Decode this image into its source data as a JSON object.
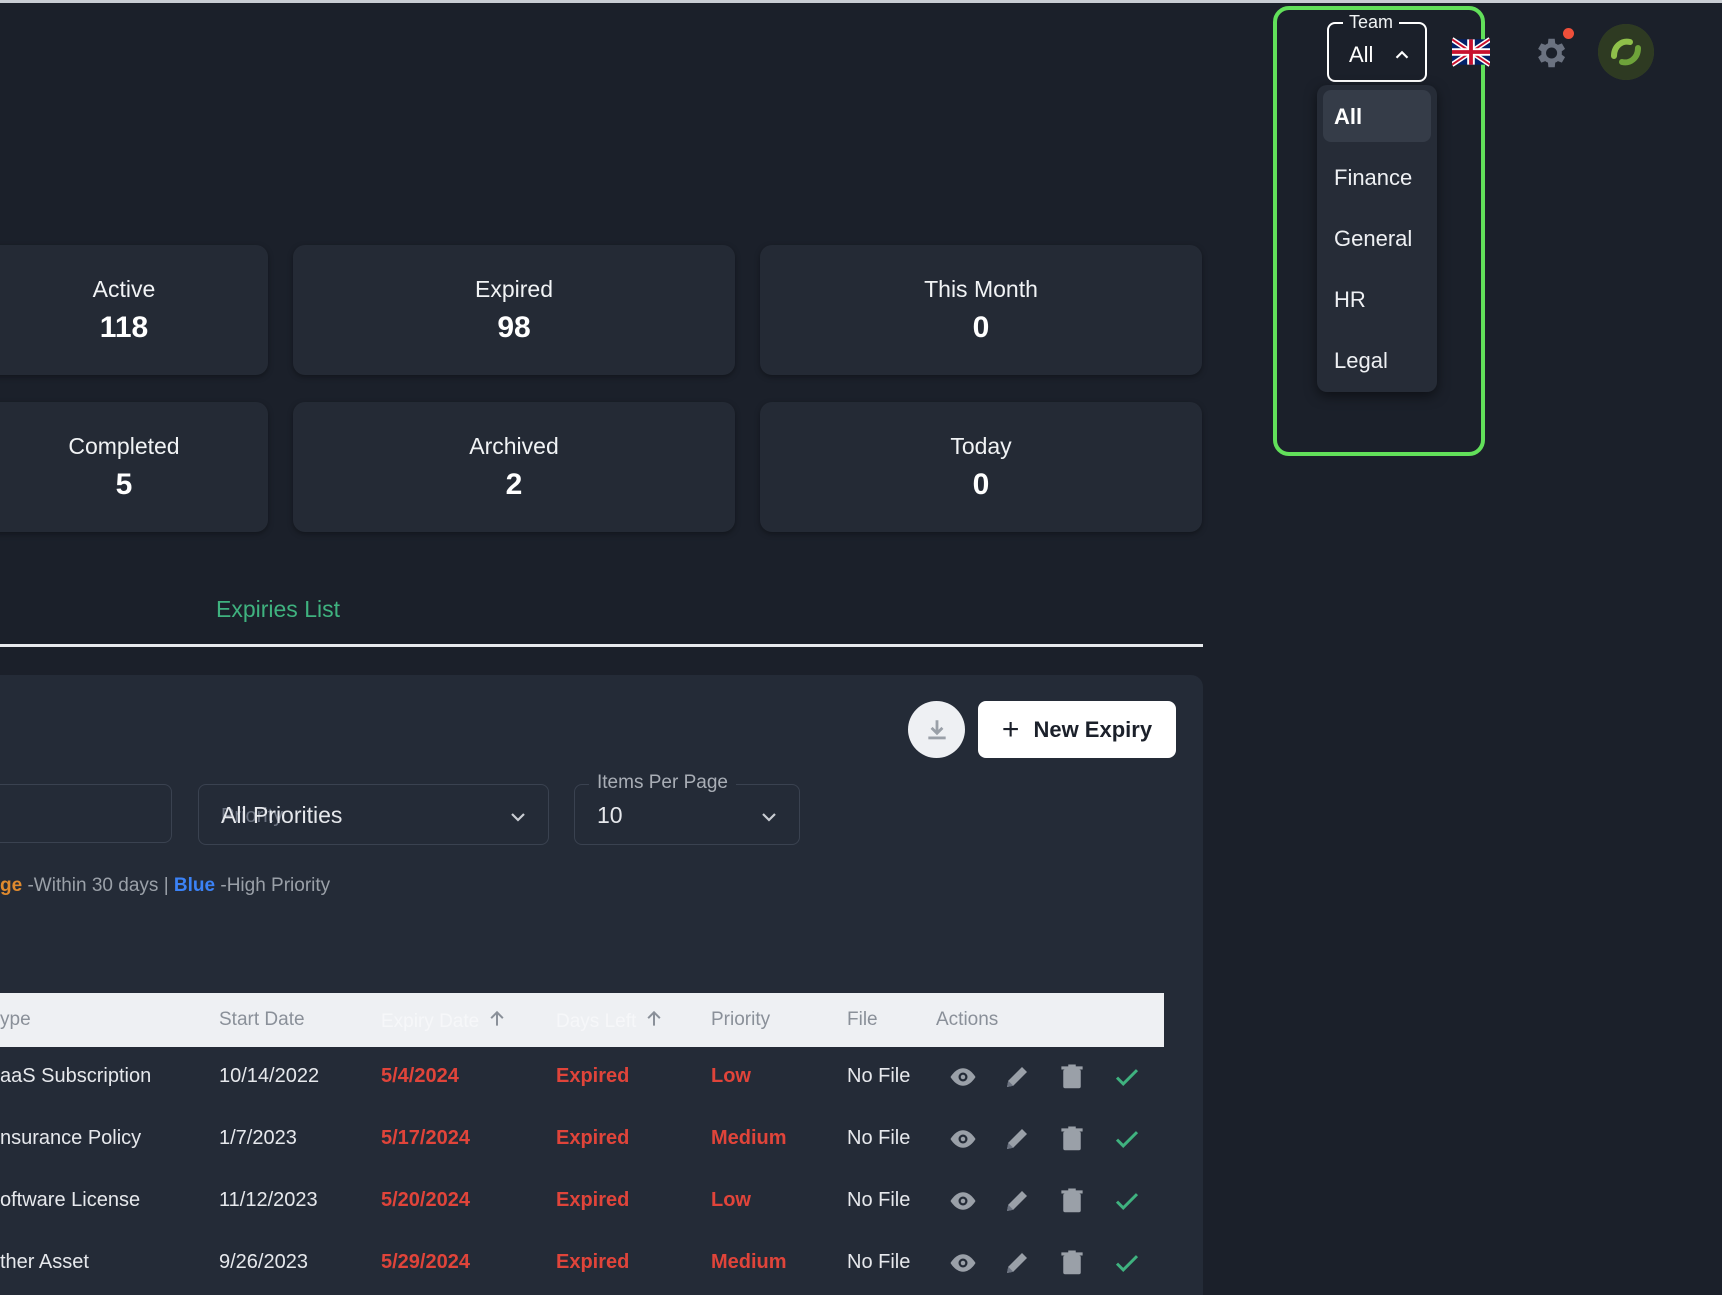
{
  "header": {
    "team_label": "Team",
    "team_value": "All",
    "team_options": [
      "All",
      "Finance",
      "General",
      "HR",
      "Legal"
    ]
  },
  "stats": [
    {
      "label": "Active",
      "value": "118"
    },
    {
      "label": "Expired",
      "value": "98"
    },
    {
      "label": "This Month",
      "value": "0"
    },
    {
      "label": "Completed",
      "value": "5"
    },
    {
      "label": "Archived",
      "value": "2"
    },
    {
      "label": "Today",
      "value": "0"
    }
  ],
  "tabs": {
    "active": "Expiries List"
  },
  "toolbar": {
    "new_label": "New Expiry"
  },
  "filters": {
    "priority_value": "All Priorities",
    "priority_ghost": "Priority",
    "items_label": "Items Per Page",
    "items_value": "10"
  },
  "legend": {
    "orange": "ge",
    "orange_desc": "-Within 30 days |",
    "blue": "Blue",
    "blue_desc": "-High Priority"
  },
  "table": {
    "headers": [
      "ype",
      "Start Date",
      "Expiry Date",
      "Days Left",
      "Priority",
      "File",
      "Actions"
    ],
    "rows": [
      {
        "type": "aaS Subscription",
        "start": "10/14/2022",
        "expiry": "5/4/2024",
        "days": "Expired",
        "priority": "Low",
        "file": "No File"
      },
      {
        "type": "nsurance Policy",
        "start": "1/7/2023",
        "expiry": "5/17/2024",
        "days": "Expired",
        "priority": "Medium",
        "file": "No File"
      },
      {
        "type": "oftware License",
        "start": "11/12/2023",
        "expiry": "5/20/2024",
        "days": "Expired",
        "priority": "Low",
        "file": "No File"
      },
      {
        "type": "ther Asset",
        "start": "9/26/2023",
        "expiry": "5/29/2024",
        "days": "Expired",
        "priority": "Medium",
        "file": "No File"
      }
    ]
  },
  "colors": {
    "accent_green": "#3fb27f",
    "expired_red": "#e0443a",
    "highlight": "#62e05a"
  }
}
